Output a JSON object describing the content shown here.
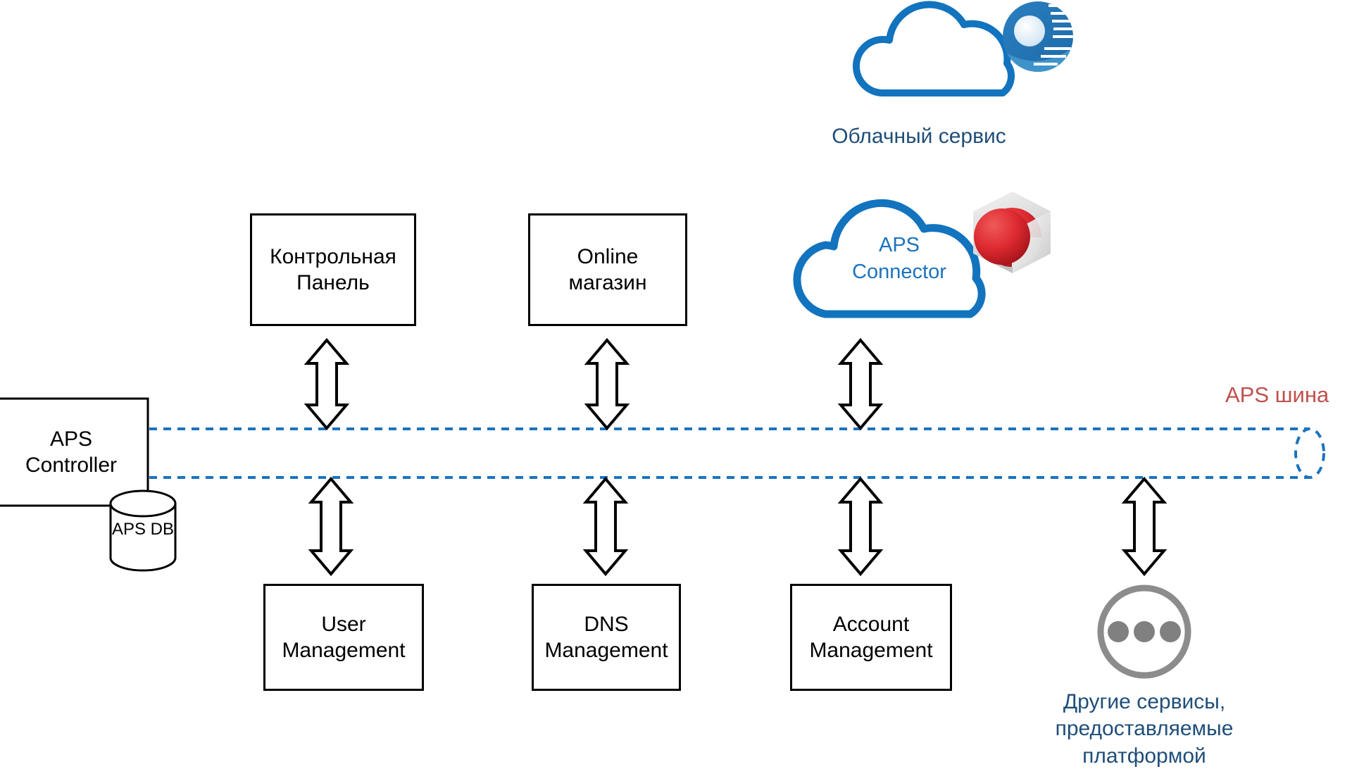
{
  "diagram": {
    "title": "APS platform architecture diagram",
    "colors": {
      "bus_line": "#1B73BE",
      "bus_label": "#C0504D",
      "cloud_stroke": "#1273BE",
      "caption_text": "#1F4E79",
      "connector_text": "#1B73BE",
      "box_stroke": "#000000",
      "dots_circle": "#808080",
      "sphere_red": "#D9242B"
    },
    "bus": {
      "label": "APS шина"
    },
    "controller": {
      "label": "APS\nController",
      "db_label": "APS DB"
    },
    "cloud_service": {
      "caption": "Облачный сервис",
      "icon": "cloud-outline-icon",
      "badge_icon": "cloud-provider-logo-icon"
    },
    "aps_connector": {
      "label": "APS\nConnector",
      "icon": "cloud-outline-icon",
      "badge_icon": "red-sphere-cube-icon"
    },
    "other_services": {
      "icon": "ellipsis-circle-icon",
      "caption": "Другие сервисы,\nпредоставляемые\nплатформой"
    },
    "top_nodes": [
      {
        "label": "Контрольная\nПанель",
        "name": "control-panel-box"
      },
      {
        "label": "Online\nмагазин",
        "name": "online-store-box"
      }
    ],
    "bottom_nodes": [
      {
        "label": "User\nManagement",
        "name": "user-management-box"
      },
      {
        "label": "DNS\nManagement",
        "name": "dns-management-box"
      },
      {
        "label": "Account\nManagement",
        "name": "account-management-box"
      }
    ],
    "connectors": [
      {
        "name": "connector-control-panel-to-bus",
        "direction": "bidirectional"
      },
      {
        "name": "connector-online-store-to-bus",
        "direction": "bidirectional"
      },
      {
        "name": "connector-aps-connector-to-bus",
        "direction": "bidirectional"
      },
      {
        "name": "connector-bus-to-user-management",
        "direction": "bidirectional"
      },
      {
        "name": "connector-bus-to-dns-management",
        "direction": "bidirectional"
      },
      {
        "name": "connector-bus-to-account-management",
        "direction": "bidirectional"
      },
      {
        "name": "connector-bus-to-other-services",
        "direction": "bidirectional"
      }
    ]
  }
}
